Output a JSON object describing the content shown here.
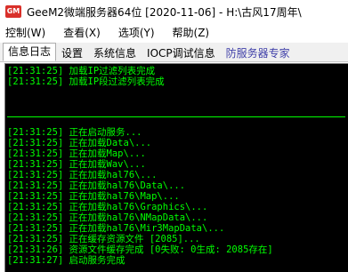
{
  "window": {
    "icon_text": "GM",
    "title": "GeeM2微端服务器64位 [2020-11-06] - H:\\古风17周年\\"
  },
  "menu": [
    {
      "label": "控制(W)"
    },
    {
      "label": "查看(X)"
    },
    {
      "label": "选项(Y)"
    },
    {
      "label": "帮助(Z)"
    }
  ],
  "tabs": [
    {
      "label": "信息日志"
    },
    {
      "label": "设置"
    },
    {
      "label": "系统信息"
    },
    {
      "label": "IOCP调试信息"
    },
    {
      "label": "防服务器专家"
    }
  ],
  "log": {
    "top_lines": [
      "[21:31:25] 加载IP过滤列表完成",
      "[21:31:25] 加载IP段过滤列表完成"
    ],
    "lines": [
      "[21:31:25] 正在启动服务...",
      "[21:31:25] 正在加载Data\\...",
      "[21:31:25] 正在加载Map\\...",
      "[21:31:25] 正在加载Wav\\...",
      "[21:31:25] 正在加载hal76\\...",
      "[21:31:25] 正在加载hal76\\Data\\...",
      "[21:31:25] 正在加载hal76\\Map\\...",
      "[21:31:25] 正在加载hal76\\Graphics\\...",
      "[21:31:25] 正在加载hal76\\NMapData\\...",
      "[21:31:25] 正在加载hal76\\Mir3MapData\\...",
      "[21:31:25] 正在缓存资源文件 [2085]...",
      "[21:31:26] 资源文件缓存完成 [0失败: 0生成: 2085存在]",
      "[21:31:27] 启动服务完成"
    ]
  }
}
